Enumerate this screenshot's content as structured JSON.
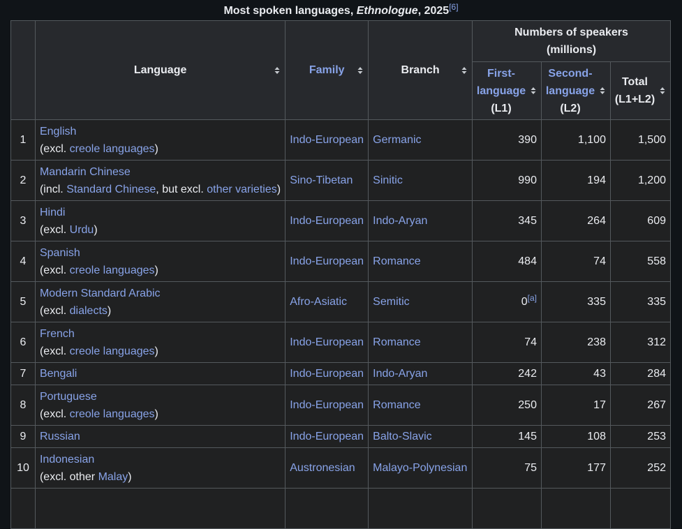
{
  "caption": {
    "prefix": "Most spoken languages, ",
    "source": "Ethnologue",
    "suffix": ", 2025",
    "ref": "[6]"
  },
  "headers": {
    "language": "Language",
    "family": "Family",
    "branch": "Branch",
    "speakers_group": "Numbers of speakers (millions)",
    "l1_link": "First-language",
    "l1_suffix": "(L1)",
    "l2_link": "Second-language",
    "l2_suffix": "(L2)",
    "total": "Total (L1+L2)"
  },
  "rows": [
    {
      "rank": "1",
      "name": "English",
      "note_pre": "(excl. ",
      "note_link1": "creole languages",
      "note_mid": "",
      "note_link2": "",
      "note_post": ")",
      "family": "Indo-European",
      "branch": "Germanic",
      "l1": "390",
      "l1_ref": "",
      "l2": "1,100",
      "total": "1,500"
    },
    {
      "rank": "2",
      "name": "Mandarin Chinese",
      "note_pre": "(incl. ",
      "note_link1": "Standard Chinese",
      "note_mid": ", but excl. ",
      "note_link2": "other varieties",
      "note_post": ")",
      "family": "Sino-Tibetan",
      "branch": "Sinitic",
      "l1": "990",
      "l1_ref": "",
      "l2": "194",
      "total": "1,200"
    },
    {
      "rank": "3",
      "name": "Hindi",
      "note_pre": "(excl. ",
      "note_link1": "Urdu",
      "note_mid": "",
      "note_link2": "",
      "note_post": ")",
      "family": "Indo-European",
      "branch": "Indo-Aryan",
      "l1": "345",
      "l1_ref": "",
      "l2": "264",
      "total": "609"
    },
    {
      "rank": "4",
      "name": "Spanish",
      "note_pre": "(excl. ",
      "note_link1": "creole languages",
      "note_mid": "",
      "note_link2": "",
      "note_post": ")",
      "family": "Indo-European",
      "branch": "Romance",
      "l1": "484",
      "l1_ref": "",
      "l2": "74",
      "total": "558"
    },
    {
      "rank": "5",
      "name": "Modern Standard Arabic",
      "note_pre": "(excl. ",
      "note_link1": "dialects",
      "note_mid": "",
      "note_link2": "",
      "note_post": ")",
      "family": "Afro-Asiatic",
      "branch": "Semitic",
      "l1": "0",
      "l1_ref": "[a]",
      "l2": "335",
      "total": "335"
    },
    {
      "rank": "6",
      "name": "French",
      "note_pre": "(excl. ",
      "note_link1": "creole languages",
      "note_mid": "",
      "note_link2": "",
      "note_post": ")",
      "family": "Indo-European",
      "branch": "Romance",
      "l1": "74",
      "l1_ref": "",
      "l2": "238",
      "total": "312"
    },
    {
      "rank": "7",
      "name": "Bengali",
      "note_pre": "",
      "note_link1": "",
      "note_mid": "",
      "note_link2": "",
      "note_post": "",
      "family": "Indo-European",
      "branch": "Indo-Aryan",
      "l1": "242",
      "l1_ref": "",
      "l2": "43",
      "total": "284"
    },
    {
      "rank": "8",
      "name": "Portuguese",
      "note_pre": "(excl. ",
      "note_link1": "creole languages",
      "note_mid": "",
      "note_link2": "",
      "note_post": ")",
      "family": "Indo-European",
      "branch": "Romance",
      "l1": "250",
      "l1_ref": "",
      "l2": "17",
      "total": "267"
    },
    {
      "rank": "9",
      "name": "Russian",
      "note_pre": "",
      "note_link1": "",
      "note_mid": "",
      "note_link2": "",
      "note_post": "",
      "family": "Indo-European",
      "branch": "Balto-Slavic",
      "l1": "145",
      "l1_ref": "",
      "l2": "108",
      "total": "253"
    },
    {
      "rank": "10",
      "name": "Indonesian",
      "note_pre": "(excl. other ",
      "note_link1": "Malay",
      "note_mid": "",
      "note_link2": "",
      "note_post": ")",
      "family": "Austronesian",
      "branch": "Malayo-Polynesian",
      "l1": "75",
      "l1_ref": "",
      "l2": "177",
      "total": "252"
    }
  ],
  "colors": {
    "page_bg": "#101418",
    "cell_bg": "#202122",
    "header_bg": "#27292d",
    "border": "#54595d",
    "link": "#88a3e8",
    "text": "#eaecf0"
  },
  "icons": {
    "sort": "sort-updown-icon"
  }
}
